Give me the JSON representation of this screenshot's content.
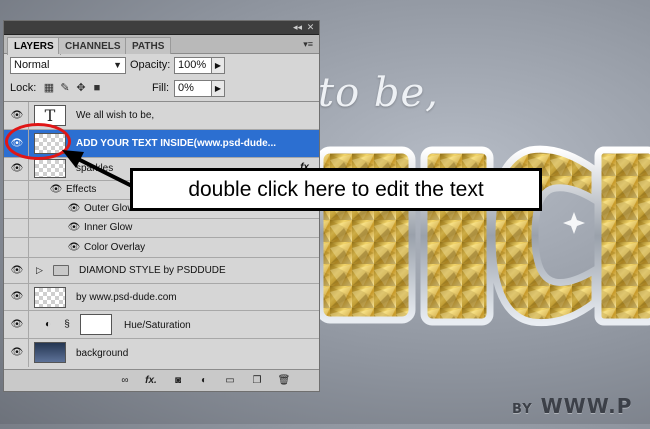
{
  "background": {
    "script_text": "to be,",
    "credit_by": "BY",
    "credit_site": "WWW.P"
  },
  "panel": {
    "tabs": [
      "LAYERS",
      "CHANNELS",
      "PATHS"
    ],
    "blend_mode": "Normal",
    "opacity_label": "Opacity:",
    "opacity_value": "100%",
    "lock_label": "Lock:",
    "fill_label": "Fill:",
    "fill_value": "0%",
    "layers": [
      {
        "name": "We all wish to be,"
      },
      {
        "name": "ADD YOUR TEXT INSIDE(www.psd-dude...",
        "selected": true
      },
      {
        "name": "sparkles"
      },
      {
        "name": "Effects"
      },
      {
        "name": "Outer Glow"
      },
      {
        "name": "Inner Glow"
      },
      {
        "name": "Color Overlay"
      },
      {
        "name": "DIAMOND STYLE by PSDDUDE"
      },
      {
        "name": "by www.psd-dude.com"
      },
      {
        "name": "Hue/Saturation"
      },
      {
        "name": "background"
      }
    ],
    "fx_label": "fx"
  },
  "callout": {
    "text": "double click here to edit the text"
  },
  "colors": {
    "selection": "#2c6fd1",
    "annotation_ring": "#e01616"
  }
}
